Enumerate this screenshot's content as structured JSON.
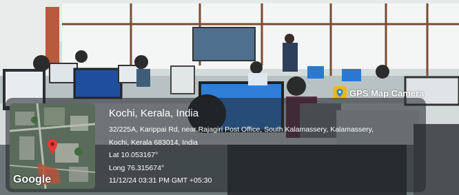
{
  "camera_app": {
    "name": "GPS Map Camera",
    "icon": "gps-map-camera-app-icon"
  },
  "location": {
    "title": "Kochi, Kerala, India",
    "address_line1": "32/225A, Karippai Rd, near Rajagiri Post Office, South Kalamassery, Kalamassery,",
    "address_line2": "Kochi, Kerala 683014, India",
    "latitude": "Lat 10.053167°",
    "longitude": "Long 76.315674°",
    "timestamp": "11/12/24 03:31 PM GMT +05:30"
  },
  "map_thumbnail": {
    "brand": "Google",
    "pin_color": "#e53935"
  }
}
